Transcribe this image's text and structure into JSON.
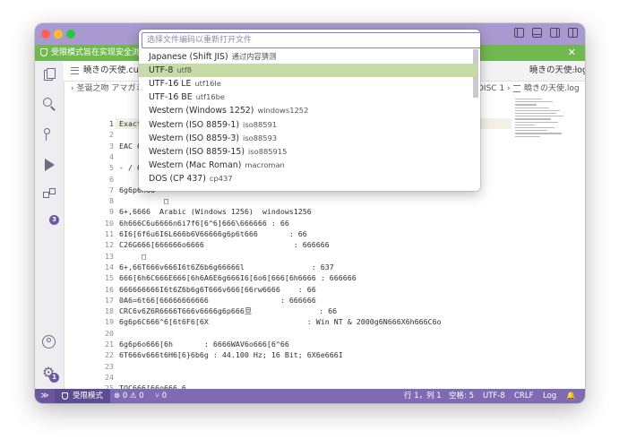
{
  "banner": {
    "text": "受限模式旨在实现安全浏览",
    "close": "✕"
  },
  "tabs": {
    "left": "曉きの天使.cue",
    "right": "曉きの天使.log",
    "more": "···"
  },
  "breadcrumb": {
    "left": "› 圣诞之吻 アマガミ",
    "right": "DISC 1 ›",
    "right_file": "曉きの天使.log"
  },
  "editor": {
    "lines": [
      {
        "n": "1",
        "text": "Exact Au"
      },
      {
        "n": "2",
        "text": ""
      },
      {
        "n": "3",
        "text": "EAC 66不"
      },
      {
        "n": "4",
        "text": ""
      },
      {
        "n": "5",
        "text": "- / 6Q66"
      },
      {
        "n": "6",
        "text": ""
      },
      {
        "n": "7",
        "text": "6g6p6h66"
      },
      {
        "n": "8",
        "text": "          □"
      },
      {
        "n": "9",
        "text": "6+,6666  Arabic (Windows 1256)  windows1256"
      },
      {
        "n": "10",
        "text": "6h666C6u6666n6i7f6[6^6]666\\666666 : 66"
      },
      {
        "n": "11",
        "text": "6I6[6f6u6I6L666b6V66666g6p6t666       : 66"
      },
      {
        "n": "12",
        "text": "C26G666[666666o6666                    : 666666"
      },
      {
        "n": "13",
        "text": "     □"
      },
      {
        "n": "14",
        "text": "6+,66T666v666I6t6Z6b6g66666l               : 637"
      },
      {
        "n": "15",
        "text": "666[6h6C666E666[6h6A6E6g666I6[6o6[666[6h6666 : 666666"
      },
      {
        "n": "16",
        "text": "666666666I6t6Z6b6g6T666v666[66rw6666    : 66"
      },
      {
        "n": "17",
        "text": "0A6=6t66[66666666666                : 666666"
      },
      {
        "n": "18",
        "text": "CRC6v6Z6R6666T666v6666g6p666旦               : 66"
      },
      {
        "n": "19",
        "text": "6g6p6C666^6[6t6F6[6X                      : Win NT & 2000g6N666X6h666C6o"
      },
      {
        "n": "20",
        "text": ""
      },
      {
        "n": "21",
        "text": "6g6p6o666[6h       : 6666WAV6o666[6^66"
      },
      {
        "n": "22",
        "text": "6T666v666t6H6[6}6b6g : 44.100 Hz; 16 Bit; 6X6e666I"
      },
      {
        "n": "23",
        "text": ""
      },
      {
        "n": "24",
        "text": ""
      },
      {
        "n": "25",
        "text": "TOC666[66o666.6"
      },
      {
        "n": "26",
        "text": ""
      }
    ]
  },
  "quickpick": {
    "placeholder": "选择文件编码以重新打开文件",
    "items": [
      {
        "label": "Japanese (Shift JIS)",
        "desc": "通过内容猜测",
        "selected": false
      },
      {
        "label": "UTF-8",
        "desc": "utf8",
        "selected": true
      },
      {
        "label": "UTF-16 LE",
        "desc": "utf16le",
        "selected": false
      },
      {
        "label": "UTF-16 BE",
        "desc": "utf16be",
        "selected": false
      },
      {
        "label": "Western (Windows 1252)",
        "desc": "windows1252",
        "selected": false
      },
      {
        "label": "Western (ISO 8859-1)",
        "desc": "iso88591",
        "selected": false
      },
      {
        "label": "Western (ISO 8859-3)",
        "desc": "iso88593",
        "selected": false
      },
      {
        "label": "Western (ISO 8859-15)",
        "desc": "iso885915",
        "selected": false
      },
      {
        "label": "Western (Mac Roman)",
        "desc": "macroman",
        "selected": false
      },
      {
        "label": "DOS (CP 437)",
        "desc": "cp437",
        "selected": false
      }
    ]
  },
  "badges": {
    "extensions": "3",
    "settings": "1"
  },
  "statusbar": {
    "remote": "≫",
    "restricted": "受限模式",
    "problems": "⊗ 0 ⚠ 0",
    "ports": "⑂ 0",
    "position": "行 1，列 1",
    "spaces": "空格: 5",
    "encoding": "UTF-8",
    "eol": "CRLF",
    "language": "Log",
    "bell": "🔔"
  },
  "colors": {
    "titlebar": "#a89ad0",
    "banner": "#71b94f",
    "statusbar": "#7e6bb3",
    "selected": "#c6dca6"
  }
}
